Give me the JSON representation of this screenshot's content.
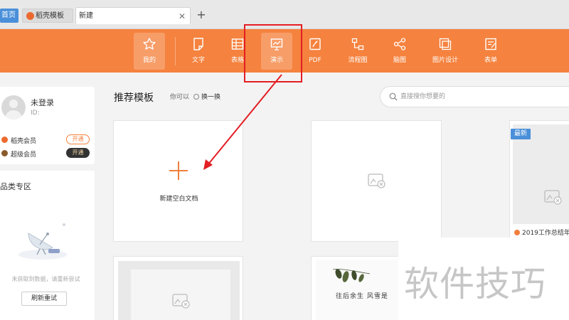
{
  "tabs": [
    {
      "label": "首页"
    },
    {
      "label": "稻壳模板"
    },
    {
      "label": "新建"
    }
  ],
  "toolbar": {
    "items": [
      {
        "label": "我的",
        "icon": "star-icon",
        "active": true
      },
      {
        "label": "文字",
        "icon": "document-icon"
      },
      {
        "label": "表格",
        "icon": "table-icon"
      },
      {
        "label": "演示",
        "icon": "presentation-icon"
      },
      {
        "label": "PDF",
        "icon": "pdf-icon"
      },
      {
        "label": "流程图",
        "icon": "flowchart-icon"
      },
      {
        "label": "脑图",
        "icon": "mindmap-icon"
      },
      {
        "label": "图片设计",
        "icon": "image-design-icon"
      },
      {
        "label": "表单",
        "icon": "form-icon"
      }
    ],
    "background": "#f5823e"
  },
  "user": {
    "name": "未登录",
    "id_label": "ID:",
    "memberships": [
      {
        "label": "稻壳会员",
        "button": "开通",
        "color": "#ec6a2f"
      },
      {
        "label": "超级会员",
        "button": "开通",
        "color": "#8a5a2b"
      }
    ]
  },
  "category": {
    "title": "品类专区",
    "empty_message": "未获取到数据，请重新尝试",
    "retry_label": "刷新重试"
  },
  "main": {
    "section_title": "推荐模板",
    "maybe_label": "你可以",
    "refresh_label": "换一换",
    "search_placeholder": "直接搜你想要的",
    "blank_label": "新建空白文档",
    "badge_new": "最新",
    "template_3_name": "2019工作总结年",
    "template_5_text": "往后余生 风雪是"
  },
  "watermark": "软件技巧",
  "annotation_color": "#e31e24"
}
